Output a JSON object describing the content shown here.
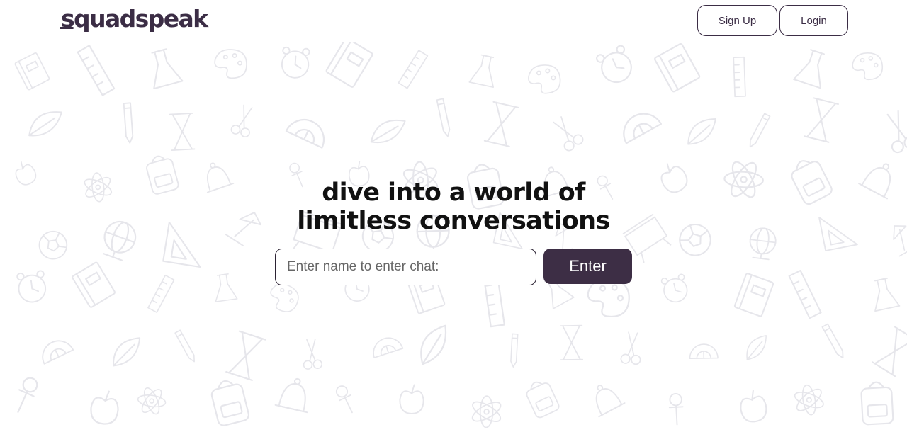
{
  "header": {
    "logo_text": "squadspeak",
    "signup_label": "Sign Up",
    "login_label": "Login"
  },
  "hero": {
    "headline_line1": "dive into a world of",
    "headline_line2": "limitless conversations"
  },
  "chat_form": {
    "name_placeholder": "Enter name to enter chat:",
    "name_value": "",
    "enter_label": "Enter"
  },
  "colors": {
    "brand": "#3b2d45",
    "button_bg": "#3d2e45",
    "doodle_stroke": "#e6e6eb"
  },
  "background": {
    "doodle_icons": [
      "book-icon",
      "globe-icon",
      "atom-icon",
      "pencil-icon",
      "ruler-icon",
      "triangle-ruler-icon",
      "backpack-icon",
      "hourglass-icon",
      "flask-icon",
      "lamp-icon",
      "bell-icon",
      "scissors-icon",
      "palette-icon",
      "board-icon",
      "pin-icon",
      "protractor-icon",
      "clock-icon",
      "ball-icon",
      "apple-icon",
      "leaf-icon"
    ]
  }
}
